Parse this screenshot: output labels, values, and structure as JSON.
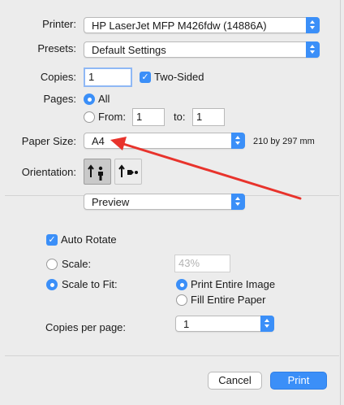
{
  "printer": {
    "label": "Printer:",
    "value": "HP LaserJet MFP M426fdw (14886A)"
  },
  "presets": {
    "label": "Presets:",
    "value": "Default Settings"
  },
  "copies": {
    "label": "Copies:",
    "value": "1",
    "two_sided_label": "Two-Sided",
    "two_sided_checked": true
  },
  "pages": {
    "label": "Pages:",
    "all_label": "All",
    "from_label": "From:",
    "from_value": "1",
    "to_label": "to:",
    "to_value": "1",
    "selected": "all"
  },
  "paper_size": {
    "label": "Paper Size:",
    "value": "A4",
    "dimensions": "210 by 297 mm"
  },
  "orientation": {
    "label": "Orientation:",
    "options": [
      "portrait",
      "landscape"
    ],
    "selected": "portrait"
  },
  "section": {
    "value": "Preview"
  },
  "preview": {
    "auto_rotate_label": "Auto Rotate",
    "auto_rotate_checked": true,
    "scale_label": "Scale:",
    "scale_value": "43%",
    "scale_to_fit_label": "Scale to Fit:",
    "print_entire_image_label": "Print Entire Image",
    "fill_entire_paper_label": "Fill Entire Paper",
    "copies_per_page_label": "Copies per page:",
    "copies_per_page_value": "1"
  },
  "buttons": {
    "cancel": "Cancel",
    "print": "Print"
  },
  "colors": {
    "accent": "#3b8ff8",
    "annotation_arrow": "#e8332c",
    "background": "#ececec"
  }
}
